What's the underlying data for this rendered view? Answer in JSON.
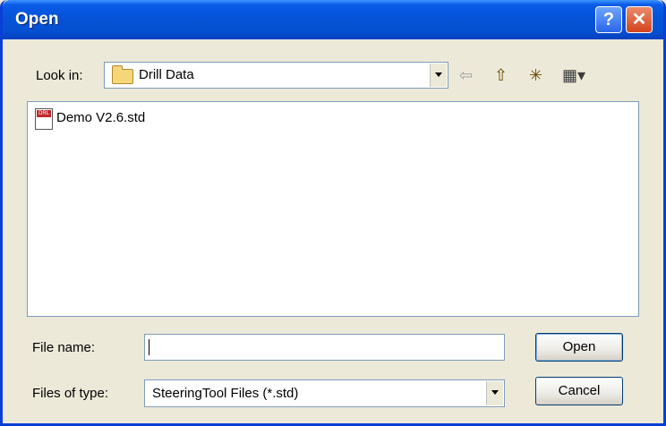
{
  "window": {
    "title": "Open"
  },
  "titlebar": {
    "help_glyph": "?",
    "close_glyph": "✕"
  },
  "lookin": {
    "label": "Look in:",
    "value": "Drill Data",
    "icon": "folder-icon"
  },
  "toolbar": {
    "back_glyph": "⇦",
    "up_glyph": "⇧",
    "newfolder_glyph": "✳",
    "views_glyph": "▦▾"
  },
  "files": [
    {
      "name": "Demo V2.6.std",
      "icon": "drill-data-file-icon"
    }
  ],
  "filename": {
    "label": "File name:",
    "value": ""
  },
  "filetype": {
    "label": "Files of type:",
    "value": "SteeringTool Files (*.std)"
  },
  "buttons": {
    "open": "Open",
    "cancel": "Cancel"
  }
}
